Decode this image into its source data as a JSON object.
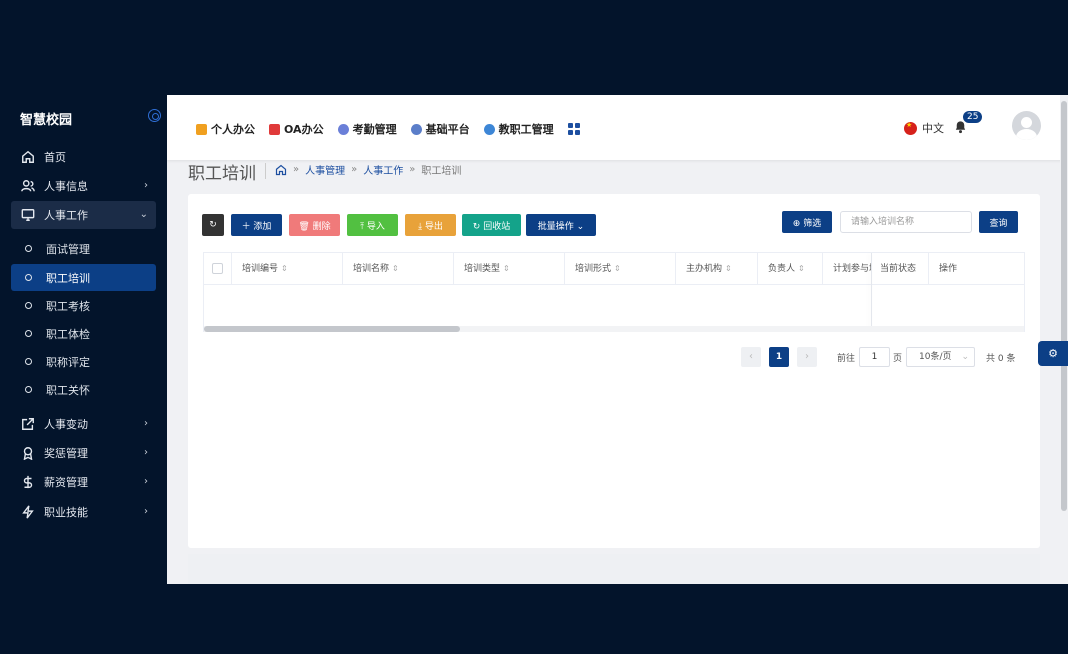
{
  "sidebar": {
    "brand": "智慧校园",
    "items": [
      {
        "label": "首页"
      },
      {
        "label": "人事信息",
        "arrow": "›"
      },
      {
        "label": "人事工作",
        "arrow": "⌄"
      },
      {
        "label": "人事变动",
        "arrow": "›"
      },
      {
        "label": "奖惩管理",
        "arrow": "›"
      },
      {
        "label": "薪资管理",
        "arrow": "›"
      },
      {
        "label": "职业技能",
        "arrow": "›"
      }
    ],
    "subitems": [
      {
        "label": "面试管理"
      },
      {
        "label": "职工培训"
      },
      {
        "label": "职工考核"
      },
      {
        "label": "职工体检"
      },
      {
        "label": "职称评定"
      },
      {
        "label": "职工关怀"
      }
    ]
  },
  "topnav": [
    {
      "label": "个人办公",
      "color": "#f0a020"
    },
    {
      "label": "OA办公",
      "color": "#e03a3a"
    },
    {
      "label": "考勤管理",
      "color": "#6a7fd8"
    },
    {
      "label": "基础平台",
      "color": "#5b7ec9"
    },
    {
      "label": "教职工管理",
      "color": "#3d86d6"
    }
  ],
  "header": {
    "language": "中文",
    "notification_count": "25"
  },
  "page": {
    "title": "职工培训",
    "breadcrumb": [
      "人事管理",
      "人事工作",
      "职工培训"
    ],
    "breadcrumb_sep": "»"
  },
  "toolbar": {
    "refresh": "↻",
    "add": "＋ 添加",
    "delete": "🗑 删除",
    "import": "⤒ 导入",
    "export": "⤓ 导出",
    "recycle": "↻ 回收站",
    "batch": "批量操作 ⌄",
    "filter": "⊕ 筛选",
    "search_placeholder": "请输入培训名称",
    "query": "查询"
  },
  "table": {
    "columns": [
      "培训编号",
      "培训名称",
      "培训类型",
      "培训形式",
      "主办机构",
      "负责人",
      "计划参与培",
      "当前状态",
      "操作"
    ],
    "sort_icon": "⇕"
  },
  "pagination": {
    "prev": "‹",
    "current": "1",
    "next": "›",
    "goto_prefix": "前往",
    "goto_value": "1",
    "goto_suffix": "页",
    "page_size": "10条/页",
    "total": "共 0 条"
  },
  "colors": {
    "primary": "#0c3f86",
    "danger": "#f07a7a",
    "success": "#52c041",
    "warning": "#e8a23a",
    "teal": "#14a38a"
  }
}
